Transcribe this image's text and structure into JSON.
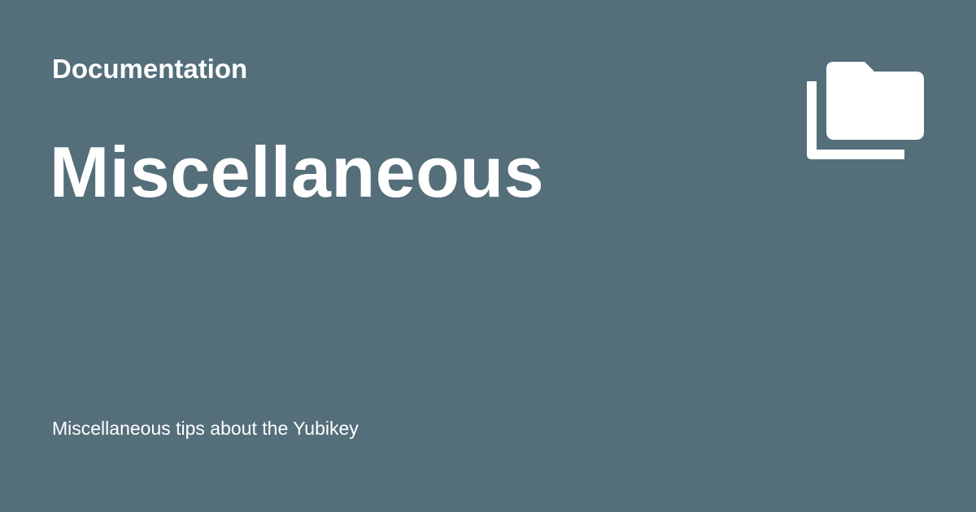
{
  "card": {
    "site_name": "Documentation",
    "title": "Miscellaneous",
    "description": "Miscellaneous tips about the Yubikey",
    "icon": "folder-multiple-icon"
  },
  "colors": {
    "background": "#546e7a",
    "foreground": "#ffffff"
  }
}
